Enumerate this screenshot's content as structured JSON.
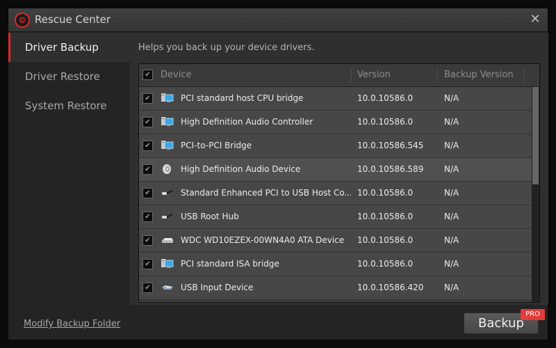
{
  "window": {
    "title": "Rescue Center",
    "close_glyph": "✕"
  },
  "sidebar": {
    "items": [
      {
        "label": "Driver Backup",
        "active": true
      },
      {
        "label": "Driver Restore",
        "active": false
      },
      {
        "label": "System Restore",
        "active": false
      }
    ]
  },
  "main": {
    "description": "Helps you back up your device drivers.",
    "table": {
      "header_checked": true,
      "columns": [
        "Device",
        "Version",
        "Backup Version"
      ],
      "rows": [
        {
          "icon": "computer-icon",
          "device": "PCI standard host CPU bridge",
          "version": "10.0.10586.0",
          "backup_version": "N/A",
          "checked": true
        },
        {
          "icon": "computer-icon",
          "device": "High Definition Audio Controller",
          "version": "10.0.10586.0",
          "backup_version": "N/A",
          "checked": true
        },
        {
          "icon": "computer-icon",
          "device": "PCI-to-PCI Bridge",
          "version": "10.0.10586.545",
          "backup_version": "N/A",
          "checked": true
        },
        {
          "icon": "speaker-icon",
          "device": "High Definition Audio Device",
          "version": "10.0.10586.589",
          "backup_version": "N/A",
          "checked": true
        },
        {
          "icon": "usb-plug-icon",
          "device": "Standard Enhanced PCI to USB Host Co...",
          "version": "10.0.10586.0",
          "backup_version": "N/A",
          "checked": true
        },
        {
          "icon": "usb-plug-icon",
          "device": "USB Root Hub",
          "version": "10.0.10586.0",
          "backup_version": "N/A",
          "checked": true
        },
        {
          "icon": "hard-drive-icon",
          "device": "WDC WD10EZEX-00WN4A0 ATA Device",
          "version": "10.0.10586.0",
          "backup_version": "N/A",
          "checked": true
        },
        {
          "icon": "computer-icon",
          "device": "PCI standard ISA bridge",
          "version": "10.0.10586.0",
          "backup_version": "N/A",
          "checked": true
        },
        {
          "icon": "usb-input-icon",
          "device": "USB Input Device",
          "version": "10.0.10586.420",
          "backup_version": "N/A",
          "checked": true
        }
      ]
    }
  },
  "footer": {
    "modify_link": "Modify Backup Folder",
    "backup_button": "Backup",
    "pro_badge": "PRO"
  },
  "colors": {
    "accent": "#e3262b",
    "pro_badge": "#e33b3b"
  }
}
